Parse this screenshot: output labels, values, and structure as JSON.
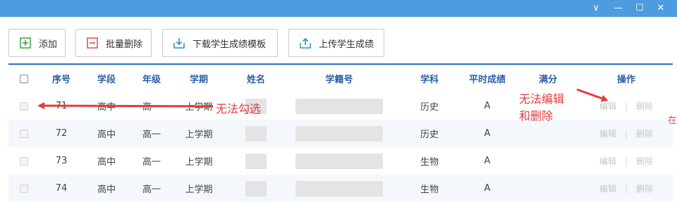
{
  "window": {
    "controls": [
      "∨",
      "—",
      "☐",
      "✕"
    ]
  },
  "toolbar": {
    "add_label": "添加",
    "batch_delete_label": "批量删除",
    "download_label": "下载学生成绩模板",
    "upload_label": "上传学生成绩"
  },
  "table": {
    "headers": [
      "序号",
      "学段",
      "年级",
      "学期",
      "姓名",
      "学籍号",
      "学科",
      "平时成绩",
      "满分",
      "操作"
    ],
    "rows": [
      {
        "seq": "71",
        "stage": "高中",
        "grade": "高一",
        "term": "上学期",
        "subject": "历史",
        "score": "A"
      },
      {
        "seq": "72",
        "stage": "高中",
        "grade": "高一",
        "term": "上学期",
        "subject": "历史",
        "score": "A"
      },
      {
        "seq": "73",
        "stage": "高中",
        "grade": "高一",
        "term": "上学期",
        "subject": "生物",
        "score": "A"
      },
      {
        "seq": "74",
        "stage": "高中",
        "grade": "高一",
        "term": "上学期",
        "subject": "生物",
        "score": "A"
      }
    ],
    "edit_label": "编辑",
    "delete_label": "删除"
  },
  "annotations": {
    "cannot_check": "无法勾选",
    "cannot_edit_line1": "无法编辑",
    "cannot_edit_line2": "和删除"
  },
  "edge_text": "在",
  "colors": {
    "titlebar": "#4d9be0",
    "header_text": "#2c5fa8",
    "annotation": "#e43b3b"
  }
}
